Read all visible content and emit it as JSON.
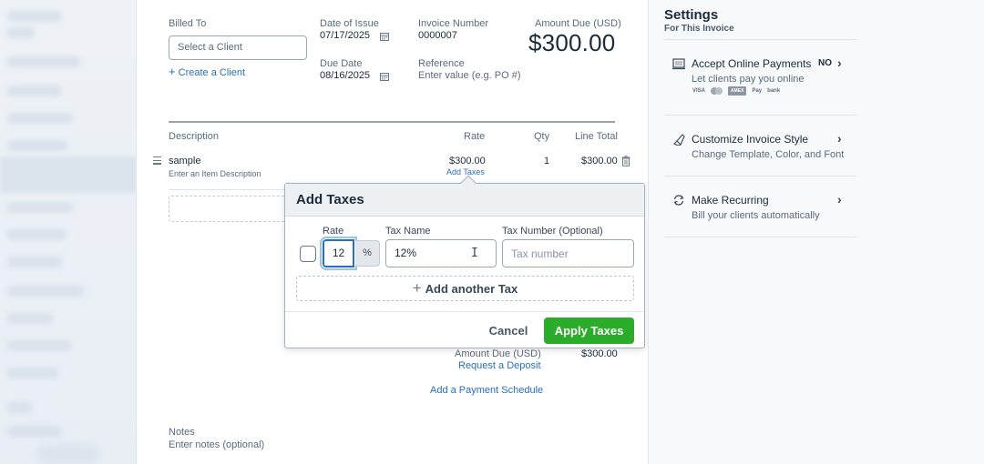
{
  "invoice": {
    "billed_to_label": "Billed To",
    "client_placeholder": "Select a Client",
    "create_client_link": "Create a Client",
    "date_of_issue_label": "Date of Issue",
    "date_of_issue": "07/17/2025",
    "due_date_label": "Due Date",
    "due_date": "08/16/2025",
    "invoice_number_label": "Invoice Number",
    "invoice_number": "0000007",
    "reference_label": "Reference",
    "reference_placeholder": "Enter value (e.g. PO #)",
    "amount_due_label": "Amount Due (USD)",
    "amount_due": "$300.00",
    "columns": {
      "description": "Description",
      "rate": "Rate",
      "qty": "Qty",
      "line_total": "Line Total"
    },
    "line_item": {
      "name": "sample",
      "description_placeholder": "Enter an Item Description",
      "rate": "$300.00",
      "add_taxes_link": "Add Taxes",
      "qty": "1",
      "line_total": "$300.00"
    },
    "footer_amount_due_label": "Amount Due (USD)",
    "footer_amount_due": "$300.00",
    "request_deposit_link": "Request a Deposit",
    "payment_schedule_link": "Add a Payment Schedule",
    "notes_label": "Notes",
    "notes_placeholder": "Enter notes (optional)"
  },
  "tax_popup": {
    "title": "Add Taxes",
    "rate_label": "Rate",
    "rate_value": "12",
    "percent_addon": "%",
    "tax_name_label": "Tax Name",
    "tax_name_value": "12%",
    "tax_number_label": "Tax Number (Optional)",
    "tax_number_placeholder": "Tax number",
    "add_another_label": "Add another Tax",
    "cancel_label": "Cancel",
    "apply_label": "Apply Taxes",
    "apply_color": "#2bac2b"
  },
  "settings": {
    "title": "Settings",
    "subtitle": "For This Invoice",
    "items": [
      {
        "title": "Accept Online Payments",
        "status": "NO",
        "description": "Let clients pay you online",
        "icon": "payment-card-icon",
        "payment_logos": [
          "VISA",
          "AMEX",
          "Pay",
          "bank"
        ]
      },
      {
        "title": "Customize Invoice Style",
        "description": "Change Template, Color, and Font",
        "icon": "paintbrush-icon"
      },
      {
        "title": "Make Recurring",
        "description": "Bill your clients automatically",
        "icon": "recurring-icon"
      }
    ]
  },
  "colors": {
    "accent_blue": "#2a6ebb",
    "apply_green": "#2bac2b"
  }
}
